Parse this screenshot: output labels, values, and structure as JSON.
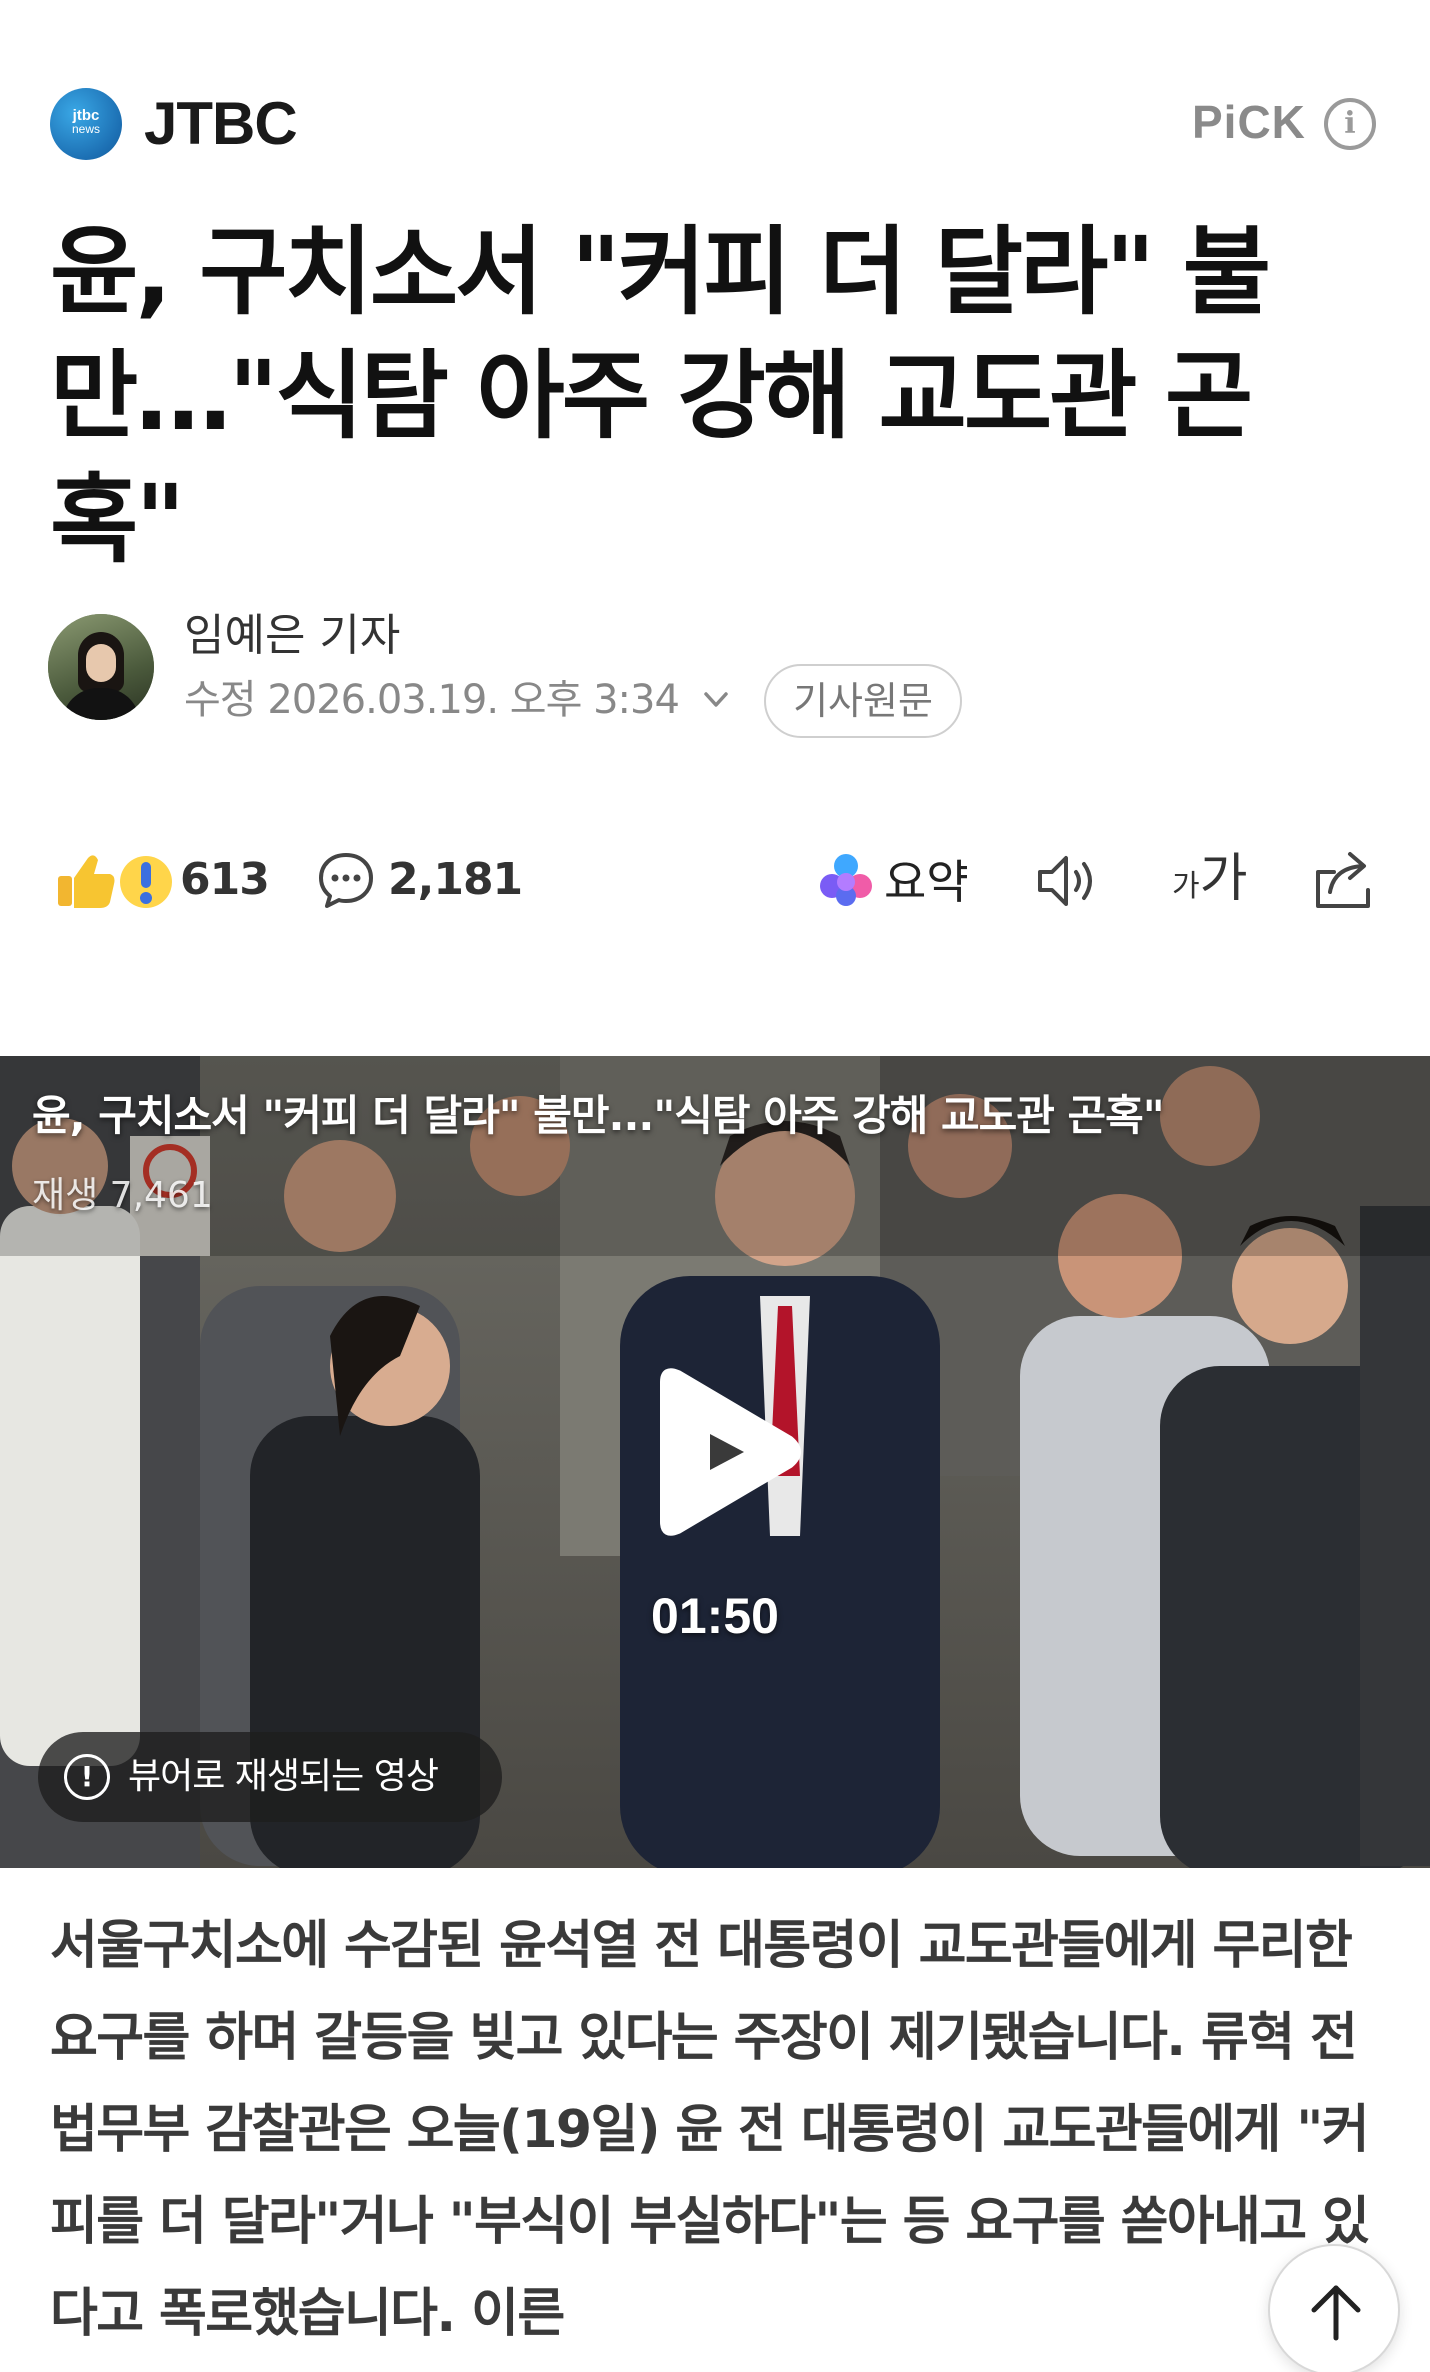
{
  "header": {
    "logo_line1": "jtbc",
    "logo_line2": "news",
    "press_name": "JTBC",
    "pick_label": "PiCK",
    "info_icon": "info-icon"
  },
  "article": {
    "title": "윤, 구치소서 \"커피 더 달라\" 불만…\"식탐 아주 강해 교도관 곤혹\"",
    "reporter": "임예은 기자",
    "date": "수정 2026.03.19. 오후 3:34",
    "original_button": "기사원문"
  },
  "toolbar": {
    "reaction_count": "613",
    "comment_count": "2,181",
    "summary_label": "요약",
    "font_small": "가",
    "font_big": "가",
    "icons": [
      "reaction-icon",
      "comment-icon",
      "summary-icon",
      "tts-icon",
      "share-icon"
    ]
  },
  "video": {
    "title": "윤, 구치소서 \"커피 더 달라\" 불만...\"식탐 아주 강해 교도관 곤혹\"",
    "views": "재생 7,461",
    "duration": "01:50",
    "notice_icon": "!",
    "notice": "뷰어로 재생되는 영상"
  },
  "body": {
    "text": "서울구치소에 수감된 윤석열 전 대통령이 교도관들에게 무리한 요구를 하며 갈등을 빚고 있다는 주장이 제기됐습니다. 류혁 전 법무부 감찰관은 오늘(19일) 윤 전 대통령이 교도관들에게 \"커피를 더 달라\"거나 \"부식이 부실하다\"는 등 요구를 쏟아내고 있다고 폭로했습니다. 이른"
  },
  "colors": {
    "accent_gray": "#8a8a8a",
    "jtbc_blue": "#1c6fb3",
    "reaction_yellow": "#f7c531",
    "summary_purple": "#6b4cf0"
  }
}
